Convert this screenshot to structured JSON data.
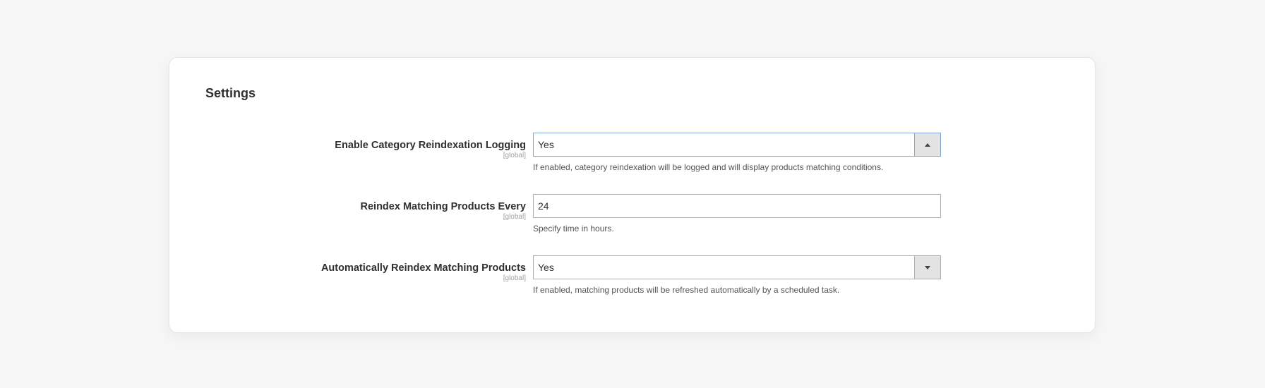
{
  "section": {
    "title": "Settings"
  },
  "fields": [
    {
      "label": "Enable Category Reindexation Logging",
      "scope": "[global]",
      "value": "Yes",
      "note": "If enabled, category reindexation will be logged and will display products matching conditions.",
      "control": "select",
      "expanded": true
    },
    {
      "label": "Reindex Matching Products Every",
      "scope": "[global]",
      "value": "24",
      "note": "Specify time in hours.",
      "control": "text"
    },
    {
      "label": "Automatically Reindex Matching Products",
      "scope": "[global]",
      "value": "Yes",
      "note": "If enabled, matching products will be refreshed automatically by a scheduled task.",
      "control": "select",
      "expanded": false
    }
  ],
  "colors": {
    "page_background": "#f6f6f6",
    "card_background": "#ffffff",
    "focus_border": "#7fa9d3",
    "arrow_button": "#e3e3e3"
  },
  "icons": {
    "select_open": "caret-up-icon",
    "select_closed": "caret-down-icon"
  }
}
